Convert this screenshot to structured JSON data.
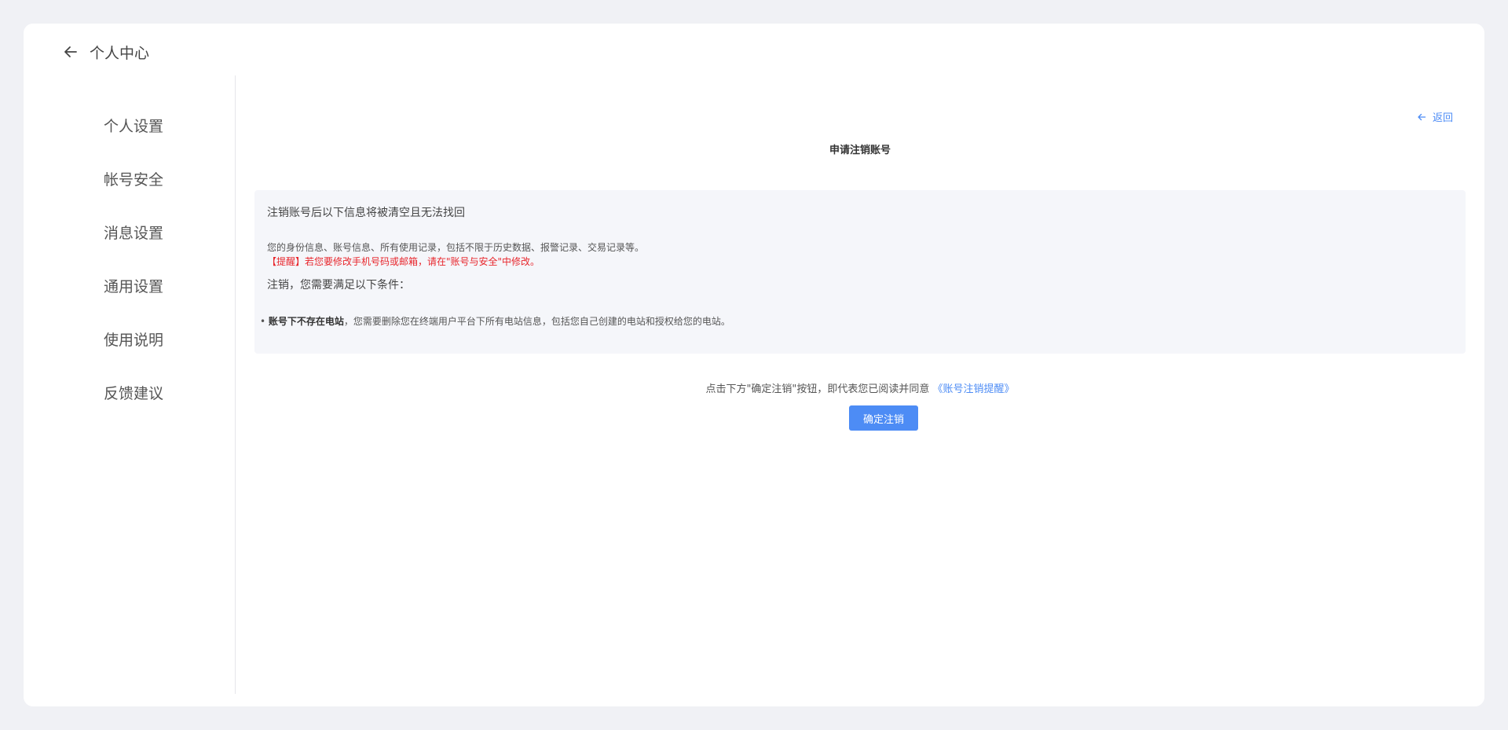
{
  "header": {
    "title": "个人中心",
    "back_icon": "arrow-left-icon"
  },
  "sidebar": {
    "items": [
      {
        "label": "个人设置"
      },
      {
        "label": "帐号安全"
      },
      {
        "label": "消息设置"
      },
      {
        "label": "通用设置"
      },
      {
        "label": "使用说明"
      },
      {
        "label": "反馈建议"
      }
    ]
  },
  "main": {
    "return_label": "返回",
    "page_title": "申请注销账号",
    "info": {
      "heading": "注销账号后以下信息将被清空且无法找回",
      "line": "您的身份信息、账号信息、所有使用记录，包括不限于历史数据、报警记录、交易记录等。",
      "warning": "【提醒】若您要修改手机号码或邮箱，请在\"账号与安全\"中修改。",
      "conditions_heading": "注销，您需要满足以下条件：",
      "bullet_bold": "账号下不存在电站",
      "bullet_text": "，您需要删除您在终端用户平台下所有电站信息，包括您自己创建的电站和授权给您的电站。"
    },
    "agree_text": "点击下方\"确定注销\"按钮，即代表您已阅读并同意",
    "agree_link": "《账号注销提醒》",
    "confirm_button": "确定注销"
  },
  "colors": {
    "accent": "#4d8cf5",
    "warning": "#e8262c",
    "background": "#f0f1f5"
  }
}
